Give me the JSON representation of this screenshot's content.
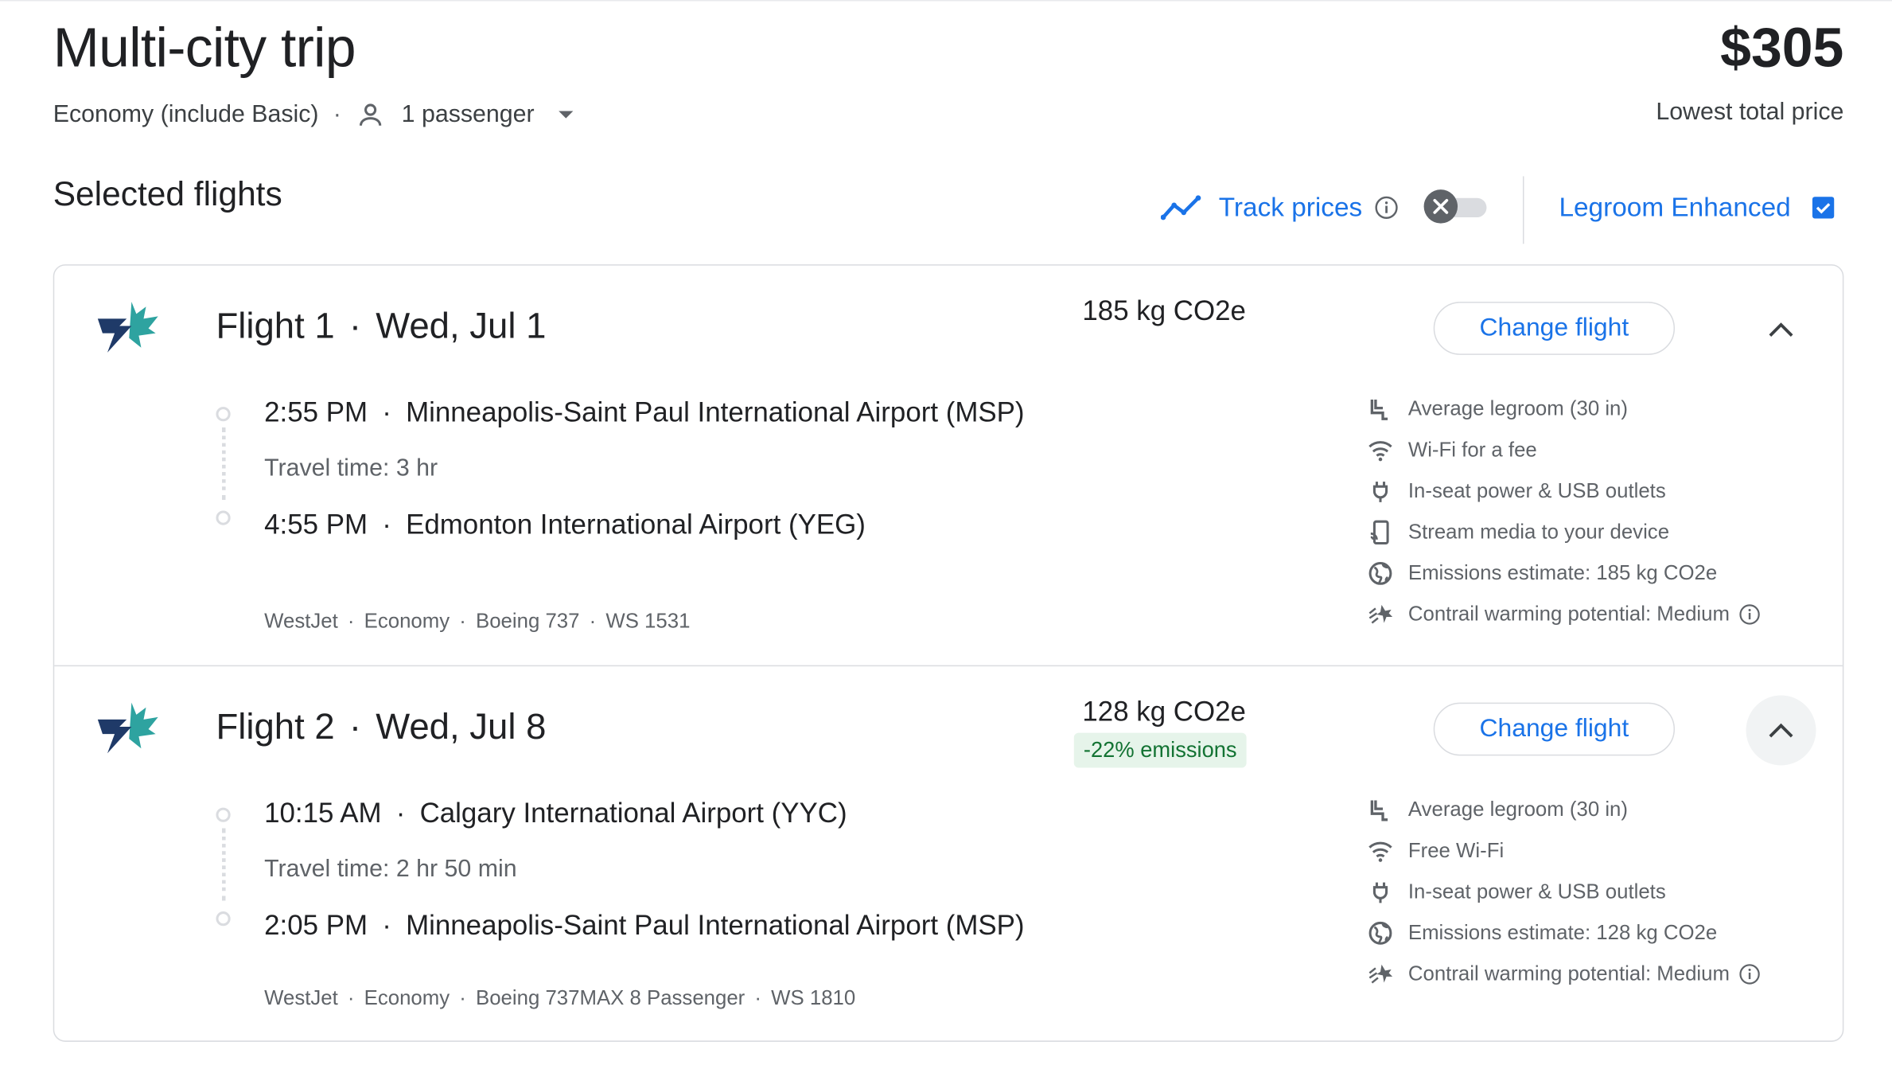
{
  "header": {
    "title": "Multi-city trip",
    "cabin": "Economy (include Basic)",
    "passengers": "1 passenger",
    "price": "$305",
    "price_label": "Lowest total price"
  },
  "controls": {
    "section_title": "Selected flights",
    "track_prices": "Track prices",
    "track_prices_on": false,
    "legroom": "Legroom Enhanced",
    "legroom_checked": true
  },
  "flights": [
    {
      "title": "Flight 1",
      "date": "Wed, Jul 1",
      "co2": "185 kg CO2e",
      "change_label": "Change flight",
      "depart_time": "2:55 PM",
      "depart_airport": "Minneapolis-Saint Paul International Airport (MSP)",
      "travel_time": "Travel time: 3 hr",
      "arrive_time": "4:55 PM",
      "arrive_airport": "Edmonton International Airport (YEG)",
      "airline": "WestJet",
      "cabin": "Economy",
      "aircraft": "Boeing 737",
      "flight_no": "WS 1531",
      "amenities": [
        {
          "icon": "legroom-icon",
          "text": "Average legroom (30 in)"
        },
        {
          "icon": "wifi-icon",
          "text": "Wi-Fi for a fee"
        },
        {
          "icon": "power-icon",
          "text": "In-seat power & USB outlets"
        },
        {
          "icon": "stream-icon",
          "text": "Stream media to your device"
        },
        {
          "icon": "globe-icon",
          "text": "Emissions estimate: 185 kg CO2e"
        },
        {
          "icon": "contrail-icon",
          "text": "Contrail warming potential: Medium"
        }
      ]
    },
    {
      "title": "Flight 2",
      "date": "Wed, Jul 8",
      "co2": "128 kg CO2e",
      "emissions_badge": "-22% emissions",
      "change_label": "Change flight",
      "depart_time": "10:15 AM",
      "depart_airport": "Calgary International Airport (YYC)",
      "travel_time": "Travel time: 2 hr 50 min",
      "arrive_time": "2:05 PM",
      "arrive_airport": "Minneapolis-Saint Paul International Airport (MSP)",
      "airline": "WestJet",
      "cabin": "Economy",
      "aircraft": "Boeing 737MAX 8 Passenger",
      "flight_no": "WS 1810",
      "amenities": [
        {
          "icon": "legroom-icon",
          "text": "Average legroom (30 in)"
        },
        {
          "icon": "wifi-icon",
          "text": "Free Wi-Fi"
        },
        {
          "icon": "power-icon",
          "text": "In-seat power & USB outlets"
        },
        {
          "icon": "globe-icon",
          "text": "Emissions estimate: 128 kg CO2e"
        },
        {
          "icon": "contrail-icon",
          "text": "Contrail warming potential: Medium"
        }
      ]
    }
  ],
  "colors": {
    "accent": "#1a73e8",
    "text": "#202124",
    "muted": "#5f6368",
    "border": "#dadce0",
    "badge_bg": "#e6f4ea",
    "badge_text": "#137333"
  }
}
